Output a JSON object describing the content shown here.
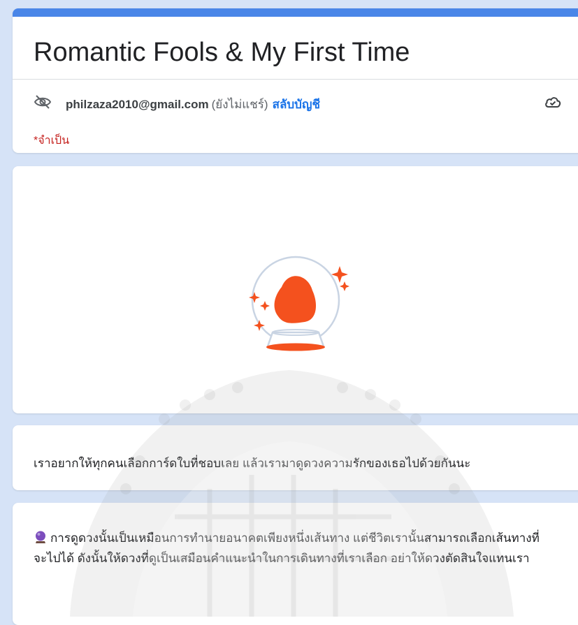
{
  "form": {
    "title": "Romantic Fools & My First Time",
    "account_email": "philzaza2010@gmail.com",
    "share_status": "(ยังไม่แชร์)",
    "switch_account": "สลับบัญชี",
    "required_note": "*จำเป็น"
  },
  "image": {
    "icon": "crystal-ball-icon"
  },
  "intro": {
    "text": "เราอยากให้ทุกคนเลือกการ์ดใบที่ชอบเลย แล้วเรามาดูดวงความรักของเธอไปด้วยกันนะ"
  },
  "info": {
    "icon": "crystal-ball-emoji-icon",
    "text": "การดูดวงนั้นเป็นเหมือนการทำนายอนาคตเพียงหนึ่งเส้นทาง แต่ชีวิตเรานั้นสามารถเลือกเส้นทางที่จะไปได้ ดังนั้นให้ดวงที่ดูเป็นเสมือนคำแนะนำในการเดินทางที่เราเลือก อย่าให้ดวงตัดสินใจแทนเรา"
  },
  "colors": {
    "accent": "#4a86e8",
    "page_background": "#d6e3f7",
    "link": "#1a73e8",
    "required": "#c5221f",
    "orb_orange": "#f4511e"
  }
}
